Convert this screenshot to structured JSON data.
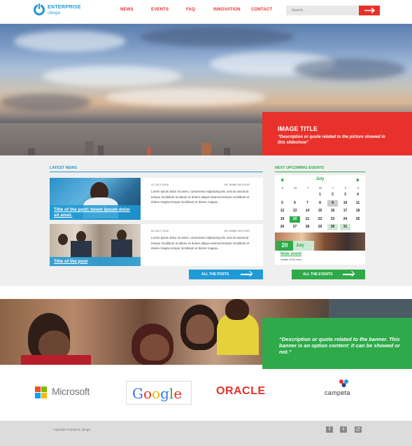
{
  "header": {
    "logo_line1": "ENTERPRISE",
    "logo_line2": "iJenga",
    "nav": [
      "NEWS",
      "EVENTS",
      "FAQ",
      "INNOVATION",
      "CONTACT"
    ],
    "search_placeholder": "Search..."
  },
  "hero": {
    "title": "IMAGE TITLE",
    "quote": "“Description or quote related to the picture showed in this slideshow”"
  },
  "news": {
    "heading": "LATEST NEWS",
    "posts": [
      {
        "title": "Title of the post: lorem ipsum dolor sit amet.",
        "date": "22 JULY 2016",
        "author": "BY NAME AUTHOR",
        "body": "Lorem ipsum dolor sit amet, consectetur adipiscing elit, sed do eiusmod tempor incididunt ut labore et dolore aliqua eiusmod tempor incididunt et dolore magna tempor incididunt ut dolore magna..."
      },
      {
        "title": "Title of the post",
        "date": "22 JULY 2016",
        "author": "BY NAME AUTHOR",
        "body": "Lorem ipsum dolor sit amet, consectetur adipiscing elit, sed do eiusmod tempor incididunt ut labore et dolore aliqua eiusmod tempor incididunt et dolore magna tempor incididunt ut dolore magna..."
      }
    ],
    "all_posts_label": "ALL THE POSTS"
  },
  "events": {
    "heading": "NEXT UPCOMING EVENTS",
    "month": "July",
    "weekdays": [
      "S",
      "M",
      "T",
      "W",
      "T",
      "F",
      "S"
    ],
    "weeks": [
      [
        "",
        "",
        "",
        "1",
        "2",
        "3",
        "4"
      ],
      [
        "5",
        "6",
        "7",
        "8",
        "9",
        "10",
        "11"
      ],
      [
        "12",
        "13",
        "14",
        "15",
        "16",
        "17",
        "18"
      ],
      [
        "19",
        "20",
        "21",
        "22",
        "23",
        "24",
        "25"
      ],
      [
        "26",
        "27",
        "28",
        "29",
        "30",
        "31",
        ""
      ]
    ],
    "today": "20",
    "selected": "9",
    "highlighted": [
      "30",
      "31"
    ],
    "feature_day": "20",
    "feature_month": "July",
    "feature_title": "Now event",
    "feature_sub": "subtitle of the event",
    "all_events_label": "ALL THE EVENTS"
  },
  "banner": {
    "quote": "“Description or quote related to the banner. This banner is an option content: it can be showed or not.”"
  },
  "partners": {
    "microsoft": "Microsoft",
    "google": [
      "G",
      "o",
      "o",
      "g",
      "l",
      "e"
    ],
    "oracle": "ORACLE",
    "campeta": "campeta"
  },
  "footer": {
    "copyright": "copyright enterprise ijenga",
    "social": [
      "facebook",
      "twitter",
      "email"
    ]
  },
  "colors": {
    "red": "#e8312a",
    "blue": "#1e9ad6",
    "green": "#2eaa4a"
  }
}
